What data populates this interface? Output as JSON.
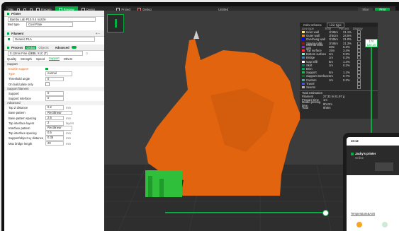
{
  "titlebar": {
    "file_menu": "File",
    "tabs": [
      "Prepare",
      "Preview",
      "Device",
      "Project",
      "Debug"
    ],
    "active_tab": 1,
    "window_title": "Untitled",
    "slice_label": "Slice",
    "print_label": "Print"
  },
  "printer": {
    "section": "Printer",
    "name": "Bambu Lab P1S 0.4 nozzle",
    "bed_type_label": "Bed type",
    "bed_type": "Cool Plate"
  },
  "filament": {
    "section": "Filament",
    "item": "Generic PLA"
  },
  "process": {
    "section": "Process",
    "mode_global": "Global",
    "mode_objects": "Objects",
    "advanced_label": "Advanced",
    "preset": "0.12mm Fine @BBL X1C (T)",
    "tabs": [
      "Quality",
      "Strength",
      "Speed",
      "Support",
      "Others"
    ],
    "active_tab": 3
  },
  "support": {
    "heading": "Support",
    "enable_label": "Enable support",
    "type_label": "Type",
    "type_value": "normal",
    "threshold_label": "Threshold angle",
    "threshold_value": "0",
    "buildplate_label": "On build plate only",
    "filament_heading": "Support filament",
    "support_label": "Support",
    "support_value": "0",
    "interface_label": "Support interface",
    "interface_value": "0",
    "advanced_heading": "Advanced",
    "params": [
      {
        "label": "Top Z distance",
        "value": "0.2",
        "unit": "mm"
      },
      {
        "label": "Base pattern",
        "value": "Rectilinear",
        "unit": ""
      },
      {
        "label": "Base pattern spacing",
        "value": "2.5",
        "unit": "mm"
      },
      {
        "label": "Top interface layers",
        "value": "2",
        "unit": "layers"
      },
      {
        "label": "Interface pattern",
        "value": "Rectilinear",
        "unit": ""
      },
      {
        "label": "Top interface spacing",
        "value": "0.5",
        "unit": "mm"
      },
      {
        "label": "Support/object xy distance",
        "value": "0.35",
        "unit": "mm"
      },
      {
        "label": "Max bridge length",
        "value": "20",
        "unit": "mm"
      }
    ]
  },
  "legend": {
    "scheme_label": "Color scheme",
    "scheme_value": "Line type",
    "columns": [
      "Line type",
      "Time",
      "Percent",
      "Display"
    ],
    "rows": [
      {
        "name": "Inner wall",
        "time": "1h35m",
        "pct": "21.1%",
        "color": "#ffe680"
      },
      {
        "name": "Outer wall",
        "time": "1h51m",
        "pct": "24.5%",
        "color": "#ff7f00"
      },
      {
        "name": "Overhang wall",
        "time": "1h35m",
        "pct": "21.0%",
        "color": "#0000ff"
      },
      {
        "name": "Sparse infill",
        "time": "1h35m",
        "pct": "21.3%",
        "color": "#8c1a1a"
      },
      {
        "name": "Internal solid infill",
        "time": "28m",
        "pct": "6.3%",
        "color": "#a020f0"
      },
      {
        "name": "Top surface",
        "time": "15m",
        "pct": "3.4%",
        "color": "#ff3333"
      },
      {
        "name": "Bottom surface",
        "time": "4m",
        "pct": "0.9%",
        "color": "#66ffcc"
      },
      {
        "name": "Bridge",
        "time": "1m",
        "pct": "0.3%",
        "color": "#4d80b3"
      },
      {
        "name": "Gap infill",
        "time": "6m",
        "pct": "1.4%",
        "color": "#ffffff"
      },
      {
        "name": "Skirt",
        "time": "1m",
        "pct": "0.2%",
        "color": "#00875a"
      },
      {
        "name": "Brim",
        "time": "",
        "pct": "",
        "color": "#00aa55"
      },
      {
        "name": "Support",
        "time": "5m",
        "pct": "1.1%",
        "color": "#00cc44"
      },
      {
        "name": "Support interface",
        "time": "3m",
        "pct": "0.7%",
        "color": "#1a6622"
      },
      {
        "name": "Custom",
        "time": "1m",
        "pct": "0.2%",
        "color": "#5e9e9e"
      },
      {
        "name": "Travel",
        "time": "",
        "pct": "",
        "color": "#4d4dff"
      },
      {
        "name": "Seams",
        "time": "",
        "pct": "",
        "color": "#b3b3b3"
      }
    ],
    "estimation_title": "Total estimation",
    "estimation": [
      {
        "label": "Filament",
        "value": "27.33 m   81.97 g"
      },
      {
        "label": "Prepare time",
        "value": "1m"
      },
      {
        "label": "Model printing time",
        "value": "8h12m"
      },
      {
        "label": "Total",
        "value": "8h8m"
      }
    ]
  },
  "layer_slider": {
    "top_value": "170",
    "top_height": "122.10",
    "bottom_value": "1"
  },
  "phone": {
    "time": "10:12",
    "printer_name": "Jacky's printer",
    "status": "Online",
    "tab_label": "Temperature&Axis"
  }
}
